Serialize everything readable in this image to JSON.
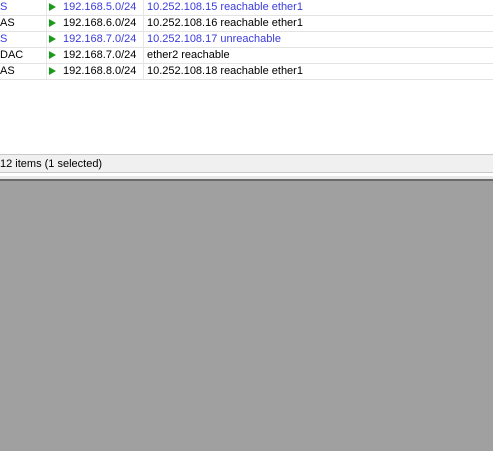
{
  "routes": [
    {
      "flags": "S",
      "dst": "192.168.5.0/24",
      "gateway": "10.252.108.15 reachable ether1",
      "style": "disabled-style"
    },
    {
      "flags": "AS",
      "dst": "192.168.6.0/24",
      "gateway": "10.252.108.16 reachable ether1",
      "style": ""
    },
    {
      "flags": "S",
      "dst": "192.168.7.0/24",
      "gateway": "10.252.108.17 unreachable",
      "style": "disabled-style"
    },
    {
      "flags": "DAC",
      "dst": "192.168.7.0/24",
      "gateway": "ether2 reachable",
      "style": ""
    },
    {
      "flags": "AS",
      "dst": "192.168.8.0/24",
      "gateway": "10.252.108.18 reachable ether1",
      "style": ""
    }
  ],
  "status": {
    "text": "12 items (1 selected)"
  },
  "icons": {
    "route_marker": "green-play-triangle-icon"
  },
  "colors": {
    "inactive_route_text": "#3b3bdc",
    "active_route_text": "#000000",
    "route_marker": "#1a9a1a",
    "desktop_background": "#a0a0a0"
  }
}
